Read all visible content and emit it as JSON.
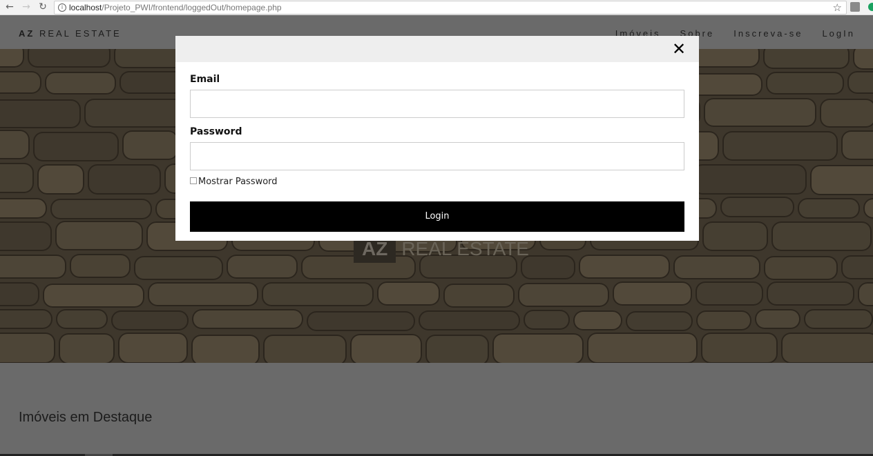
{
  "browser": {
    "url_host": "localhost",
    "url_path": "/Projeto_PWI/frontend/loggedOut/homepage.php"
  },
  "navbar": {
    "brand_bold": "AZ",
    "brand_rest": " REAL ESTATE",
    "links": [
      "Imóveis",
      "Sobre",
      "Inscreva-se",
      "LogIn"
    ]
  },
  "hero": {
    "logo_box": "AZ",
    "logo_text": "REAL ESTATE"
  },
  "featured": {
    "title": "Imóveis em Destaque"
  },
  "modal": {
    "close_symbol": "✕",
    "email_label": "Email",
    "email_value": "",
    "password_label": "Password",
    "password_value": "",
    "show_password_label": "Mostrar Password",
    "login_button": "Login"
  },
  "icons": {
    "back": "arrow-left-icon",
    "forward": "arrow-right-icon",
    "reload": "reload-icon",
    "info": "info-icon",
    "bookmark": "star-icon",
    "close": "close-icon"
  },
  "colors": {
    "login_button_bg": "#000000",
    "modal_header_bg": "#eeeeee",
    "overlay": "#6a6a6a"
  }
}
